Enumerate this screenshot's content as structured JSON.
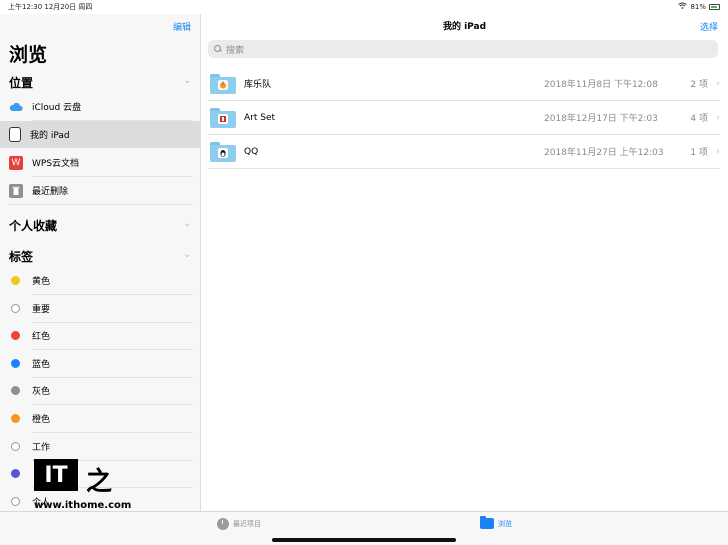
{
  "status_bar": {
    "time_date": "上午12:30   12月20日 周四",
    "battery": "81%"
  },
  "sidebar": {
    "edit_label": "编辑",
    "title": "浏览",
    "locations_header": "位置",
    "locations": [
      {
        "label": "iCloud 云盘",
        "icon": "icloud-icon"
      },
      {
        "label": "我的 iPad",
        "icon": "ipad-icon",
        "selected": true
      },
      {
        "label": "WPS云文档",
        "icon": "wps-icon"
      },
      {
        "label": "最近删除",
        "icon": "trash-icon"
      }
    ],
    "favorites_header": "个人收藏",
    "tags_header": "标签",
    "tags": [
      {
        "label": "黄色",
        "color": "#f5c518"
      },
      {
        "label": "重要",
        "color": "outline"
      },
      {
        "label": "红色",
        "color": "#f0443a"
      },
      {
        "label": "蓝色",
        "color": "#1a82f7"
      },
      {
        "label": "灰色",
        "color": "#8e8e93"
      },
      {
        "label": "橙色",
        "color": "#f5961e"
      },
      {
        "label": "工作",
        "color": "outline"
      },
      {
        "label": "",
        "color": "#5856d6"
      },
      {
        "label": "个人",
        "color": "outline"
      }
    ]
  },
  "main": {
    "title": "我的 iPad",
    "select_label": "选择",
    "search_placeholder": "搜索",
    "files": [
      {
        "name": "库乐队",
        "date": "2018年11月8日 下午12:08",
        "count": "2 项",
        "badge": "garageband-icon"
      },
      {
        "name": "Art Set",
        "date": "2018年12月17日 下午2:03",
        "count": "4 项",
        "badge": "art-set-icon"
      },
      {
        "name": "QQ",
        "date": "2018年11月27日 上午12:03",
        "count": "1 项",
        "badge": "qq-icon"
      }
    ]
  },
  "tabbar": {
    "recent_label": "最近项目",
    "browse_label": "浏览"
  },
  "watermark": {
    "logo": "IT之家",
    "url": "www.ithome.com"
  }
}
